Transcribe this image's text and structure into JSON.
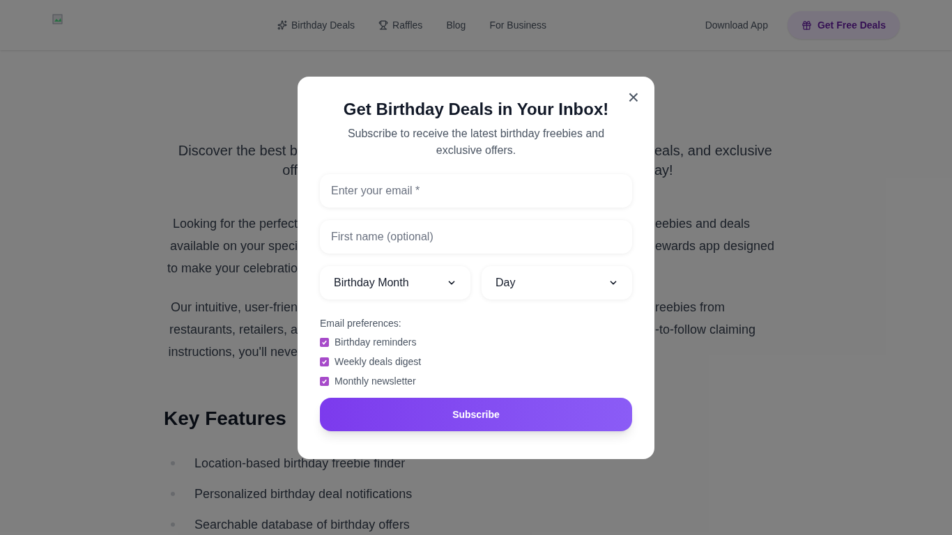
{
  "header": {
    "nav": [
      {
        "label": "Birthday Deals",
        "kind": "sparkle"
      },
      {
        "label": "Raffles",
        "kind": "trophy"
      },
      {
        "label": "Blog",
        "kind": "plain"
      },
      {
        "label": "For Business",
        "kind": "plain"
      }
    ],
    "download_link": "Download App",
    "cta": "Get Free Deals"
  },
  "page": {
    "hero_lines": [
      {
        "left": "Discover the best b",
        "right": "eals, and exclusive"
      },
      {
        "left": "off",
        "right": "ay!"
      }
    ],
    "paragraphs": [
      [
        {
          "left": "Looking for the perfect",
          "right": "eebies and deals"
        },
        {
          "left": "available on your speci",
          "right": "ewards app designed"
        },
        {
          "left": "to make your celebratio"
        }
      ],
      [
        {
          "left": "Our intuitive, user-frien",
          "right": "reebies from"
        },
        {
          "left": "restaurants, retailers, a",
          "right": "-to-follow claiming"
        },
        {
          "left": "instructions, you'll neve"
        }
      ]
    ],
    "features_heading": "Key Features",
    "features": [
      "Location-based birthday freebie finder",
      "Personalized birthday deal notifications",
      "Searchable database of birthday offers"
    ]
  },
  "modal": {
    "close": "×",
    "title": "Get Birthday Deals in Your Inbox!",
    "subtitle": "Subscribe to receive the latest birthday freebies and exclusive offers.",
    "email": {
      "placeholder": "Enter your email *"
    },
    "first_name": {
      "placeholder": "First name (optional)"
    },
    "month": {
      "value": "Birthday Month"
    },
    "day": {
      "value": "Day"
    },
    "preferences_label": "Email preferences:",
    "preferences": [
      {
        "label": "Birthday reminders",
        "checked": true
      },
      {
        "label": "Weekly deals digest",
        "checked": true
      },
      {
        "label": "Monthly newsletter",
        "checked": true
      }
    ],
    "submit": "Subscribe"
  }
}
